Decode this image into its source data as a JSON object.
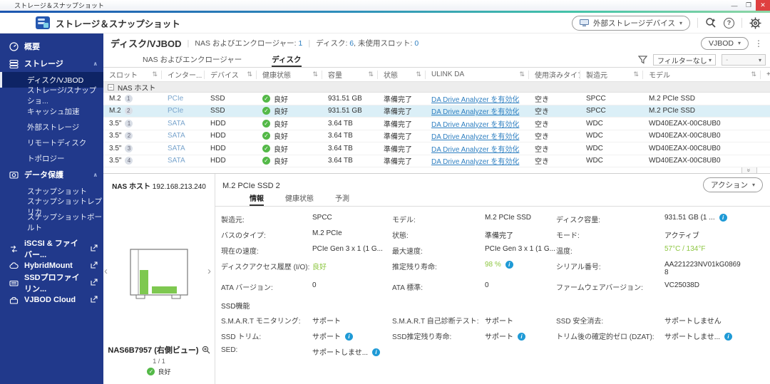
{
  "colors": {
    "sidebar_bg": "#21398b",
    "sidebar_selected": "#0e2465",
    "accent_link": "#2e7fc1",
    "interface_blue": "#7aa5cd",
    "ok_green": "#54b948",
    "value_green": "#8cc63f",
    "info_blue": "#1f9ad6",
    "selected_row": "#dbeff7",
    "close_red": "#df4040",
    "nas_bar_green": "#7ec850"
  },
  "window": {
    "title": "ストレージ＆スナップショット",
    "minimize": "—",
    "maximize": "❐",
    "close": "✕"
  },
  "appbar": {
    "title": "ストレージ＆スナップショット",
    "external_device_button": "外部ストレージデバイス",
    "help": "?"
  },
  "sidebar": {
    "overview": "概要",
    "storage_section": "ストレージ",
    "storage_items": [
      {
        "label": "ディスク/VJBOD",
        "selected": true
      },
      {
        "label": "ストレージ/スナップショ...",
        "selected": false
      },
      {
        "label": "キャッシュ加速",
        "selected": false
      },
      {
        "label": "外部ストレージ",
        "selected": false
      },
      {
        "label": "リモートディスク",
        "selected": false
      },
      {
        "label": "トポロジー",
        "selected": false
      }
    ],
    "protection_section": "データ保護",
    "protection_items": [
      {
        "label": "スナップショット"
      },
      {
        "label": "スナップショットレプリカ"
      },
      {
        "label": "スナップショットボールト"
      }
    ],
    "external_items": [
      {
        "label": "iSCSI & ファイバー..."
      },
      {
        "label": "HybridMount"
      },
      {
        "label": "SSDプロファイリン..."
      },
      {
        "label": "VJBOD Cloud"
      }
    ]
  },
  "page": {
    "title": "ディスク/VJBOD",
    "enclosures_label": "NAS およびエンクロージャー:",
    "enclosures_value": "1",
    "disks_label": "ディスク:",
    "disks_value": "6",
    "slots_label": ", 未使用スロット:",
    "slots_value": "0",
    "vjbod_button": "VJBOD"
  },
  "tabs": {
    "nas": "NAS およびエンクロージャー",
    "disk": "ディスク"
  },
  "filterbar": {
    "filter_none": "フィルターなし",
    "disabled_value": "-"
  },
  "table": {
    "columns": {
      "slot": "スロット",
      "iface": "インター...",
      "device": "デバイス",
      "health": "健康状態",
      "capacity": "容量",
      "status": "状態",
      "ulink": "ULINK DA",
      "used": "使用済みタイプ",
      "vendor": "製造元",
      "model": "モデル",
      "add": "+"
    },
    "group": "NAS ホスト",
    "rows": [
      {
        "slot": "M.2",
        "num": "1",
        "iface": "PCIe",
        "device": "SSD",
        "health": "良好",
        "capacity": "931.51 GB",
        "status": "準備完了",
        "ulink": "DA Drive Analyzer を有効化",
        "used": "空き",
        "vendor": "SPCC",
        "model": "M.2 PCIe SSD"
      },
      {
        "slot": "M.2",
        "num": "2",
        "iface": "PCIe",
        "device": "SSD",
        "health": "良好",
        "capacity": "931.51 GB",
        "status": "準備完了",
        "ulink": "DA Drive Analyzer を有効化",
        "used": "空き",
        "vendor": "SPCC",
        "model": "M.2 PCIe SSD"
      },
      {
        "slot": "3.5\"",
        "num": "1",
        "iface": "SATA",
        "device": "HDD",
        "health": "良好",
        "capacity": "3.64 TB",
        "status": "準備完了",
        "ulink": "DA Drive Analyzer を有効化",
        "used": "空き",
        "vendor": "WDC",
        "model": "WD40EZAX-00C8UB0"
      },
      {
        "slot": "3.5\"",
        "num": "2",
        "iface": "SATA",
        "device": "HDD",
        "health": "良好",
        "capacity": "3.64 TB",
        "status": "準備完了",
        "ulink": "DA Drive Analyzer を有効化",
        "used": "空き",
        "vendor": "WDC",
        "model": "WD40EZAX-00C8UB0"
      },
      {
        "slot": "3.5\"",
        "num": "3",
        "iface": "SATA",
        "device": "HDD",
        "health": "良好",
        "capacity": "3.64 TB",
        "status": "準備完了",
        "ulink": "DA Drive Analyzer を有効化",
        "used": "空き",
        "vendor": "WDC",
        "model": "WD40EZAX-00C8UB0"
      },
      {
        "slot": "3.5\"",
        "num": "4",
        "iface": "SATA",
        "device": "HDD",
        "health": "良好",
        "capacity": "3.64 TB",
        "status": "準備完了",
        "ulink": "DA Drive Analyzer を有効化",
        "used": "空き",
        "vendor": "WDC",
        "model": "WD40EZAX-00C8UB0"
      }
    ]
  },
  "carousel": {
    "host_label": "NAS ホスト",
    "ip": "192.168.213.240",
    "caption": "NAS6B7957 (右側ビュー)",
    "page": "1 / 1",
    "status": "良好",
    "prev": "‹",
    "next": "›"
  },
  "detail": {
    "title": "M.2 PCIe SSD 2",
    "action_button": "アクション",
    "tabs": {
      "info": "情報",
      "health": "健康状態",
      "forecast": "予測"
    },
    "ssd_section": "SSD機能",
    "fields": {
      "manufacturer_l": "製造元:",
      "manufacturer_v": "SPCC",
      "model_l": "モデル:",
      "model_v": "M.2 PCIe SSD",
      "capacity_l": "ディスク容量:",
      "capacity_v": "931.51 GB (1 ...",
      "bus_l": "バスのタイプ:",
      "bus_v": "M.2 PCIe",
      "status_l": "状態:",
      "status_v": "準備完了",
      "mode_l": "モード:",
      "mode_v": "アクティブ",
      "cur_speed_l": "現在の速度:",
      "cur_speed_v": "PCIe Gen 3 x 1 (1 G...",
      "max_speed_l": "最大速度:",
      "max_speed_v": "PCIe Gen 3 x 1 (1 G...",
      "temp_l": "温度:",
      "temp_v": "57°C / 134°F",
      "access_l": "ディスクアクセス履歴 (I/O):",
      "access_v": "良好",
      "life_l": "推定残り寿命:",
      "life_v": "98 %",
      "serial_l": "シリアル番号:",
      "serial_v": "AA221223NV01kG08698",
      "ata_ver_l": "ATA バージョン:",
      "ata_ver_v": "0",
      "ata_std_l": "ATA 標準:",
      "ata_std_v": "0",
      "fw_l": "ファームウェアバージョン:",
      "fw_v": "VC25038D",
      "smart_mon_l": "S.M.A.R.T モニタリング:",
      "smart_mon_v": "サポート",
      "smart_test_l": "S.M.A.R.T 自己診断テスト:",
      "smart_test_v": "サポート",
      "erase_l": "SSD 安全消去:",
      "erase_v": "サポートしません",
      "trim_l": "SSD トリム:",
      "trim_v": "サポート",
      "life_sup_l": "SSD推定残り寿命:",
      "life_sup_v": "サポート",
      "dzat_l": "トリム後の確定的ゼロ (DZAT):",
      "dzat_v": "サポートしませ...",
      "sed_l": "SED:",
      "sed_v": "サポートしませ..."
    }
  }
}
